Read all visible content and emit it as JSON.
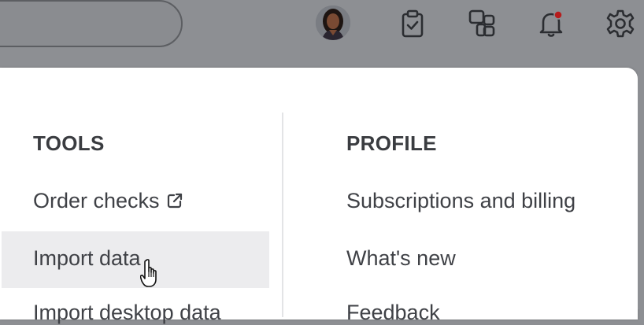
{
  "topbar": {
    "icons": [
      "clipboard-check-icon",
      "apps-icon",
      "bell-icon",
      "gear-icon"
    ],
    "notification_dot_color": "#c62828"
  },
  "menu": {
    "tools": {
      "heading": "TOOLS",
      "items": [
        "Order checks",
        "Import data",
        "Import desktop data"
      ]
    },
    "profile": {
      "heading": "PROFILE",
      "items": [
        "Subscriptions and billing",
        "What's new",
        "Feedback"
      ]
    },
    "hovered_item": "Import data"
  }
}
